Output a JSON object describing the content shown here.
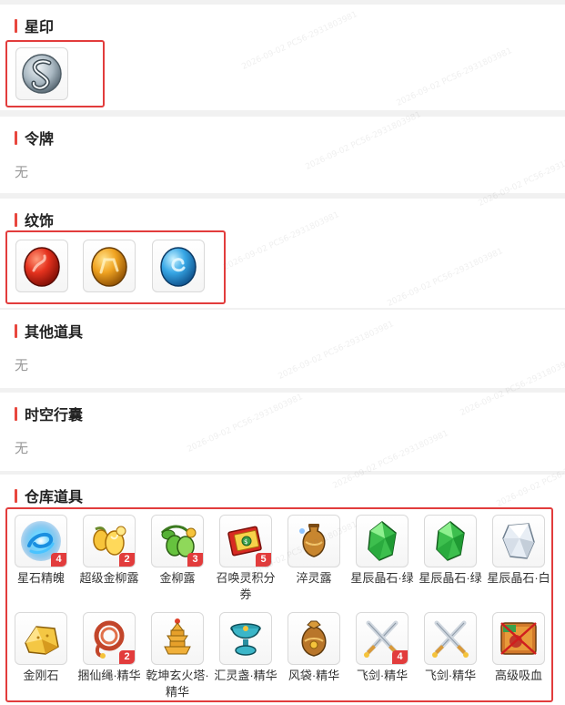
{
  "sections": {
    "xingyin": {
      "title": "星印"
    },
    "lingpai": {
      "title": "令牌",
      "empty": "无"
    },
    "wenshi": {
      "title": "纹饰"
    },
    "other": {
      "title": "其他道具",
      "empty": "无"
    },
    "shikong": {
      "title": "时空行囊",
      "empty": "无"
    },
    "cangku": {
      "title": "仓库道具"
    }
  },
  "xingyin_items": [
    {
      "icon": "silver-swirl-icon"
    }
  ],
  "wenshi_items": [
    {
      "icon": "red-gem-icon"
    },
    {
      "icon": "orange-gem-icon"
    },
    {
      "icon": "blue-gem-icon"
    }
  ],
  "warehouse_items": [
    {
      "name": "星石精魄",
      "count": "4",
      "icon": "blue-essence-icon"
    },
    {
      "name": "超级金柳露",
      "count": "2",
      "icon": "golden-dew-icon"
    },
    {
      "name": "金柳露",
      "count": "3",
      "icon": "green-dew-icon"
    },
    {
      "name": "召唤灵积分券",
      "count": "5",
      "icon": "red-coupon-icon"
    },
    {
      "name": "淬灵露",
      "count": "",
      "icon": "vase-icon"
    },
    {
      "name": "星辰晶石·绿",
      "count": "",
      "icon": "green-crystal-icon"
    },
    {
      "name": "星辰晶石·绿",
      "count": "",
      "icon": "green-crystal-icon"
    },
    {
      "name": "星辰晶石·白",
      "count": "",
      "icon": "white-crystal-icon"
    },
    {
      "name": "金刚石",
      "count": "",
      "icon": "yellow-stone-icon"
    },
    {
      "name": "捆仙绳·精华",
      "count": "2",
      "icon": "rope-icon"
    },
    {
      "name": "乾坤玄火塔·精华",
      "count": "",
      "icon": "tower-icon"
    },
    {
      "name": "汇灵盏·精华",
      "count": "",
      "icon": "cup-icon"
    },
    {
      "name": "风袋·精华",
      "count": "",
      "icon": "wind-bag-icon"
    },
    {
      "name": "飞剑·精华",
      "count": "4",
      "icon": "crossed-swords-icon"
    },
    {
      "name": "飞剑·精华",
      "count": "",
      "icon": "crossed-swords-icon"
    },
    {
      "name": "高级吸血",
      "count": "",
      "icon": "skill-book-icon"
    }
  ],
  "colors": {
    "accent": "#e8473e",
    "highlight_box": "#e23c3c"
  },
  "watermark": "2026-09-02   PC56-2931803981"
}
